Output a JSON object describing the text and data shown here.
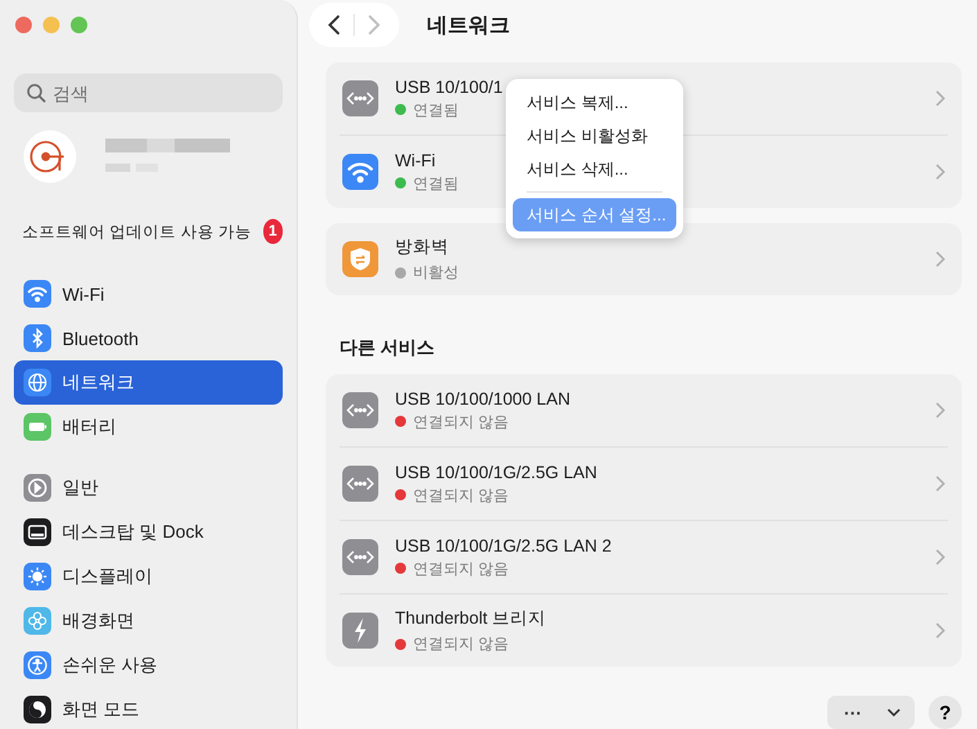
{
  "sidebar": {
    "search": {
      "placeholder": "검색"
    },
    "update_notice": {
      "label": "소프트웨어 업데이트 사용 가능",
      "badge": "1"
    },
    "groups": [
      [
        {
          "label": "Wi-Fi",
          "kind": "wifi",
          "selected": false
        },
        {
          "label": "Bluetooth",
          "kind": "bluetooth",
          "selected": false
        },
        {
          "label": "네트워크",
          "kind": "network",
          "selected": true
        },
        {
          "label": "배터리",
          "kind": "battery",
          "selected": false
        }
      ],
      [
        {
          "label": "일반",
          "kind": "general",
          "selected": false
        },
        {
          "label": "데스크탑 및 Dock",
          "kind": "dock",
          "selected": false
        },
        {
          "label": "디스플레이",
          "kind": "display",
          "selected": false
        },
        {
          "label": "배경화면",
          "kind": "wallpaper",
          "selected": false
        },
        {
          "label": "손쉬운 사용",
          "kind": "accessibility",
          "selected": false
        },
        {
          "label": "화면 모드",
          "kind": "screenmode",
          "selected": false
        }
      ]
    ]
  },
  "toolbar": {
    "title": "네트워크"
  },
  "cards": [
    [
      {
        "name": "USB 10/100/1",
        "kind": "ethernet",
        "status": "연결됨",
        "color": "#3dbb4f"
      },
      {
        "name": "Wi-Fi",
        "kind": "wifi",
        "status": "연결됨",
        "color": "#3dbb4f"
      }
    ],
    [
      {
        "name": "방화벽",
        "kind": "firewall",
        "status": "비활성",
        "color": "#a8a8a8"
      }
    ]
  ],
  "other_services": {
    "heading": "다른 서비스",
    "items": [
      {
        "name": "USB 10/100/1000 LAN",
        "kind": "ethernet",
        "status": "연결되지 않음",
        "color": "#e5383b"
      },
      {
        "name": "USB 10/100/1G/2.5G LAN",
        "kind": "ethernet",
        "status": "연결되지 않음",
        "color": "#e5383b"
      },
      {
        "name": "USB 10/100/1G/2.5G LAN 2",
        "kind": "ethernet",
        "status": "연결되지 않음",
        "color": "#e5383b"
      },
      {
        "name": "Thunderbolt 브리지",
        "kind": "thunderbolt",
        "status": "연결되지 않음",
        "color": "#e5383b"
      }
    ]
  },
  "bottom": {
    "more_button": "···",
    "help_button": "?"
  },
  "context_menu": {
    "items": [
      {
        "label": "서비스 복제...",
        "selected": false
      },
      {
        "label": "서비스 비활성화",
        "selected": false
      },
      {
        "label": "서비스 삭제...",
        "selected": false
      },
      {
        "label": "서비스 순서 설정...",
        "selected": true
      }
    ]
  }
}
